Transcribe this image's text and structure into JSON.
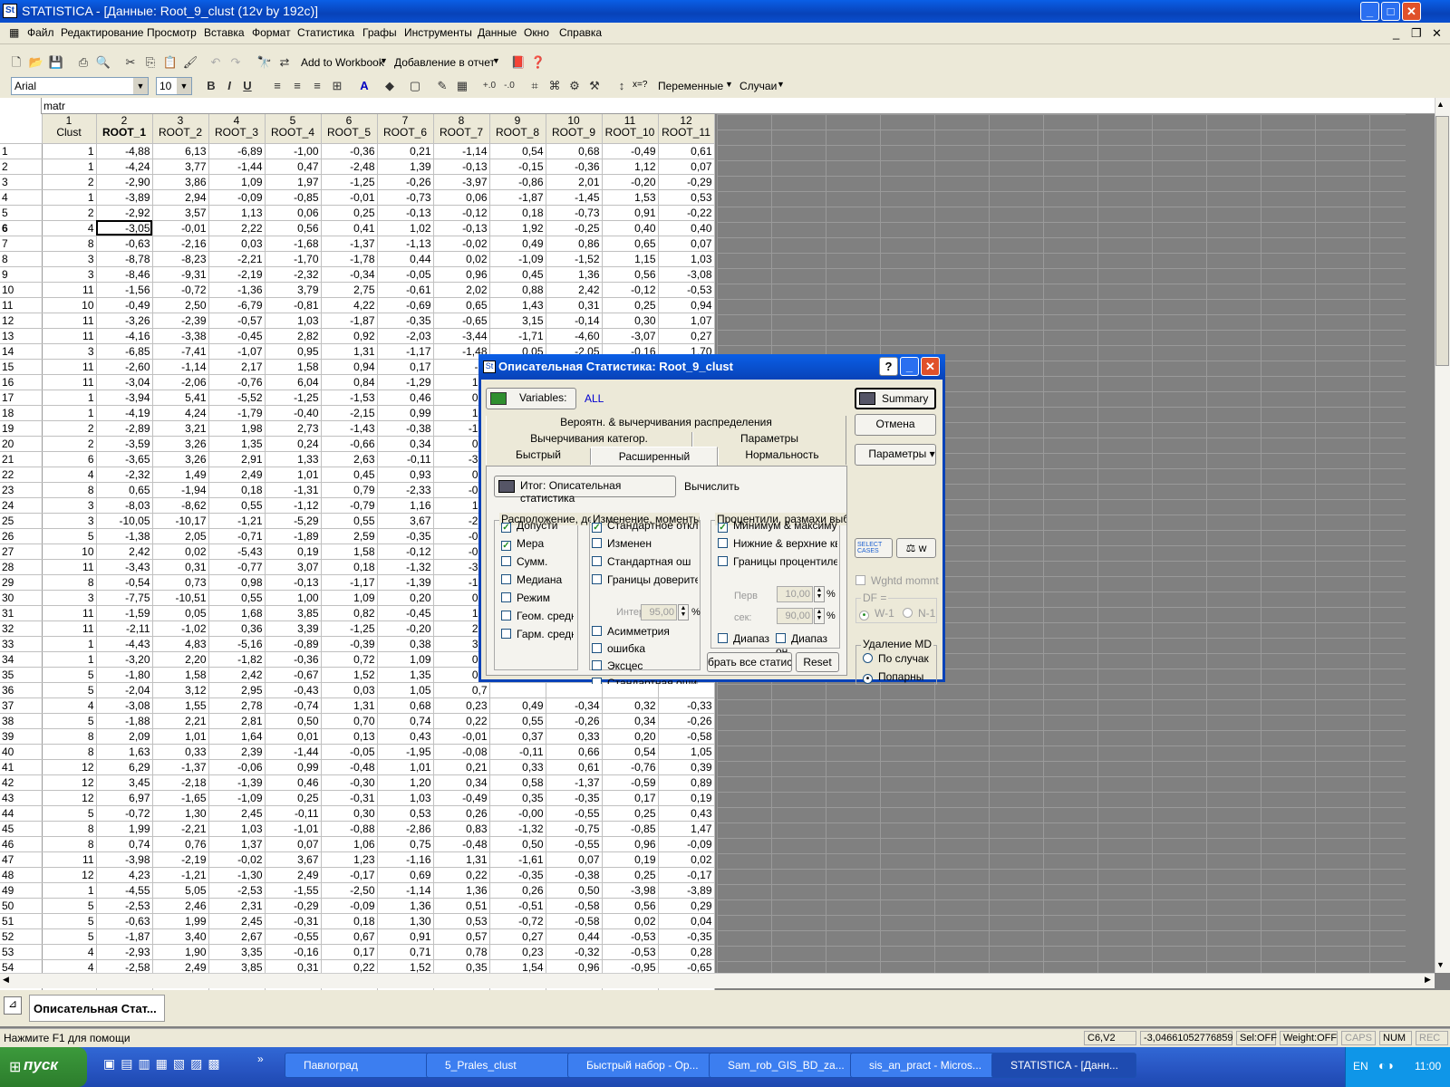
{
  "window": {
    "title": "STATISTICA - [Данные: Root_9_clust (12v by 192c)]"
  },
  "menu": [
    "Файл",
    "Редактирование",
    "Просмотр",
    "Вставка",
    "Формат",
    "Статистика",
    "Графы",
    "Инструменты",
    "Данные",
    "Окно",
    "Справка"
  ],
  "toolbar": {
    "add_to_workbook": "Add to Workbook",
    "add_to_report": "Добавление в отчет",
    "variables": "Переменные",
    "cases": "Случаи",
    "font": "Arial",
    "size": "10"
  },
  "sheet": {
    "title": "matr",
    "col_numbers": [
      "1",
      "2",
      "3",
      "4",
      "5",
      "6",
      "7",
      "8",
      "9",
      "10",
      "11",
      "12"
    ],
    "col_names": [
      "Clust",
      "ROOT_1",
      "ROOT_2",
      "ROOT_3",
      "ROOT_4",
      "ROOT_5",
      "ROOT_6",
      "ROOT_7",
      "ROOT_8",
      "ROOT_9",
      "ROOT_10",
      "ROOT_11"
    ],
    "rows": [
      [
        "1",
        "1",
        "-4,88",
        "6,13",
        "-6,89",
        "-1,00",
        "-0,36",
        "0,21",
        "-1,14",
        "0,54",
        "0,68",
        "-0,49",
        "0,61"
      ],
      [
        "2",
        "1",
        "-4,24",
        "3,77",
        "-1,44",
        "0,47",
        "-2,48",
        "1,39",
        "-0,13",
        "-0,15",
        "-0,36",
        "1,12",
        "0,07"
      ],
      [
        "3",
        "2",
        "-2,90",
        "3,86",
        "1,09",
        "1,97",
        "-1,25",
        "-0,26",
        "-3,97",
        "-0,86",
        "2,01",
        "-0,20",
        "-0,29"
      ],
      [
        "4",
        "1",
        "-3,89",
        "2,94",
        "-0,09",
        "-0,85",
        "-0,01",
        "-0,73",
        "0,06",
        "-1,87",
        "-1,45",
        "1,53",
        "0,53"
      ],
      [
        "5",
        "2",
        "-2,92",
        "3,57",
        "1,13",
        "0,06",
        "0,25",
        "-0,13",
        "-0,12",
        "0,18",
        "-0,73",
        "0,91",
        "-0,22"
      ],
      [
        "6",
        "4",
        "-3,05",
        "-0,01",
        "2,22",
        "0,56",
        "0,41",
        "1,02",
        "-0,13",
        "1,92",
        "-0,25",
        "0,40",
        "0,40"
      ],
      [
        "7",
        "8",
        "-0,63",
        "-2,16",
        "0,03",
        "-1,68",
        "-1,37",
        "-1,13",
        "-0,02",
        "0,49",
        "0,86",
        "0,65",
        "0,07"
      ],
      [
        "8",
        "3",
        "-8,78",
        "-8,23",
        "-2,21",
        "-1,70",
        "-1,78",
        "0,44",
        "0,02",
        "-1,09",
        "-1,52",
        "1,15",
        "1,03"
      ],
      [
        "9",
        "3",
        "-8,46",
        "-9,31",
        "-2,19",
        "-2,32",
        "-0,34",
        "-0,05",
        "0,96",
        "0,45",
        "1,36",
        "0,56",
        "-3,08"
      ],
      [
        "10",
        "11",
        "-1,56",
        "-0,72",
        "-1,36",
        "3,79",
        "2,75",
        "-0,61",
        "2,02",
        "0,88",
        "2,42",
        "-0,12",
        "-0,53"
      ],
      [
        "11",
        "10",
        "-0,49",
        "2,50",
        "-6,79",
        "-0,81",
        "4,22",
        "-0,69",
        "0,65",
        "1,43",
        "0,31",
        "0,25",
        "0,94"
      ],
      [
        "12",
        "11",
        "-3,26",
        "-2,39",
        "-0,57",
        "1,03",
        "-1,87",
        "-0,35",
        "-0,65",
        "3,15",
        "-0,14",
        "0,30",
        "1,07"
      ],
      [
        "13",
        "11",
        "-4,16",
        "-3,38",
        "-0,45",
        "2,82",
        "0,92",
        "-2,03",
        "-3,44",
        "-1,71",
        "-4,60",
        "-3,07",
        "0,27"
      ],
      [
        "14",
        "3",
        "-6,85",
        "-7,41",
        "-1,07",
        "0,95",
        "1,31",
        "-1,17",
        "-1,48",
        "0,05",
        "-2,05",
        "-0,16",
        "1,70"
      ],
      [
        "15",
        "11",
        "-2,60",
        "-1,14",
        "2,17",
        "1,58",
        "0,94",
        "0,17",
        "-2,",
        "",
        "",
        "",
        ""
      ],
      [
        "16",
        "11",
        "-3,04",
        "-2,06",
        "-0,76",
        "6,04",
        "0,84",
        "-1,29",
        "1,7",
        "",
        "",
        "",
        ""
      ],
      [
        "17",
        "1",
        "-3,94",
        "5,41",
        "-5,52",
        "-1,25",
        "-1,53",
        "0,46",
        "0,2",
        "",
        "",
        "",
        ""
      ],
      [
        "18",
        "1",
        "-4,19",
        "4,24",
        "-1,79",
        "-0,40",
        "-2,15",
        "0,99",
        "1,4",
        "",
        "",
        "",
        ""
      ],
      [
        "19",
        "2",
        "-2,89",
        "3,21",
        "1,98",
        "2,73",
        "-1,43",
        "-0,38",
        "-1,9",
        "",
        "",
        "",
        ""
      ],
      [
        "20",
        "2",
        "-3,59",
        "3,26",
        "1,35",
        "0,24",
        "-0,66",
        "0,34",
        "0,1",
        "",
        "",
        "",
        ""
      ],
      [
        "21",
        "6",
        "-3,65",
        "3,26",
        "2,91",
        "1,33",
        "2,63",
        "-0,11",
        "-3,1",
        "",
        "",
        "",
        ""
      ],
      [
        "22",
        "4",
        "-2,32",
        "1,49",
        "2,49",
        "1,01",
        "0,45",
        "0,93",
        "0,6",
        "",
        "",
        "",
        ""
      ],
      [
        "23",
        "8",
        "0,65",
        "-1,94",
        "0,18",
        "-1,31",
        "0,79",
        "-2,33",
        "-0,6",
        "",
        "",
        "",
        ""
      ],
      [
        "24",
        "3",
        "-8,03",
        "-8,62",
        "0,55",
        "-1,12",
        "-0,79",
        "1,16",
        "1,0",
        "",
        "",
        "",
        ""
      ],
      [
        "25",
        "3",
        "-10,05",
        "-10,17",
        "-1,21",
        "-5,29",
        "0,55",
        "3,67",
        "-2,3",
        "",
        "",
        "",
        ""
      ],
      [
        "26",
        "5",
        "-1,38",
        "2,05",
        "-0,71",
        "-1,89",
        "2,59",
        "-0,35",
        "-0,1",
        "",
        "",
        "",
        ""
      ],
      [
        "27",
        "10",
        "2,42",
        "0,02",
        "-5,43",
        "0,19",
        "1,58",
        "-0,12",
        "-0,6",
        "",
        "",
        "",
        ""
      ],
      [
        "28",
        "11",
        "-3,43",
        "0,31",
        "-0,77",
        "3,07",
        "0,18",
        "-1,32",
        "-3,8",
        "",
        "",
        "",
        ""
      ],
      [
        "29",
        "8",
        "-0,54",
        "0,73",
        "0,98",
        "-0,13",
        "-1,17",
        "-1,39",
        "-1,3",
        "",
        "",
        "",
        ""
      ],
      [
        "30",
        "3",
        "-7,75",
        "-10,51",
        "0,55",
        "1,00",
        "1,09",
        "0,20",
        "0,2",
        "",
        "",
        "",
        ""
      ],
      [
        "31",
        "11",
        "-1,59",
        "0,05",
        "1,68",
        "3,85",
        "0,82",
        "-0,45",
        "1,0",
        "",
        "",
        "",
        ""
      ],
      [
        "32",
        "11",
        "-2,11",
        "-1,02",
        "0,36",
        "3,39",
        "-1,25",
        "-0,20",
        "2,2",
        "",
        "",
        "",
        ""
      ],
      [
        "33",
        "1",
        "-4,43",
        "4,83",
        "-5,16",
        "-0,89",
        "-0,39",
        "0,38",
        "3,1",
        "",
        "",
        "",
        ""
      ],
      [
        "34",
        "1",
        "-3,20",
        "2,20",
        "-1,82",
        "-0,36",
        "0,72",
        "1,09",
        "0,5",
        "",
        "",
        "",
        ""
      ],
      [
        "35",
        "5",
        "-1,80",
        "1,58",
        "2,42",
        "-0,67",
        "1,52",
        "1,35",
        "0,2",
        "",
        "",
        "",
        ""
      ],
      [
        "36",
        "5",
        "-2,04",
        "3,12",
        "2,95",
        "-0,43",
        "0,03",
        "1,05",
        "0,7",
        "",
        "",
        "",
        ""
      ],
      [
        "37",
        "4",
        "-3,08",
        "1,55",
        "2,78",
        "-0,74",
        "1,31",
        "0,68",
        "0,23",
        "0,49",
        "-0,34",
        "0,32",
        "-0,33"
      ],
      [
        "38",
        "5",
        "-1,88",
        "2,21",
        "2,81",
        "0,50",
        "0,70",
        "0,74",
        "0,22",
        "0,55",
        "-0,26",
        "0,34",
        "-0,26"
      ],
      [
        "39",
        "8",
        "2,09",
        "1,01",
        "1,64",
        "0,01",
        "0,13",
        "0,43",
        "-0,01",
        "0,37",
        "0,33",
        "0,20",
        "-0,58"
      ],
      [
        "40",
        "8",
        "1,63",
        "0,33",
        "2,39",
        "-1,44",
        "-0,05",
        "-1,95",
        "-0,08",
        "-0,11",
        "0,66",
        "0,54",
        "1,05"
      ],
      [
        "41",
        "12",
        "6,29",
        "-1,37",
        "-0,06",
        "0,99",
        "-0,48",
        "1,01",
        "0,21",
        "0,33",
        "0,61",
        "-0,76",
        "0,39"
      ],
      [
        "42",
        "12",
        "3,45",
        "-2,18",
        "-1,39",
        "0,46",
        "-0,30",
        "1,20",
        "0,34",
        "0,58",
        "-1,37",
        "-0,59",
        "0,89"
      ],
      [
        "43",
        "12",
        "6,97",
        "-1,65",
        "-1,09",
        "0,25",
        "-0,31",
        "1,03",
        "-0,49",
        "0,35",
        "-0,35",
        "0,17",
        "0,19"
      ],
      [
        "44",
        "5",
        "-0,72",
        "1,30",
        "2,45",
        "-0,11",
        "0,30",
        "0,53",
        "0,26",
        "-0,00",
        "-0,55",
        "0,25",
        "0,43"
      ],
      [
        "45",
        "8",
        "1,99",
        "-2,21",
        "1,03",
        "-1,01",
        "-0,88",
        "-2,86",
        "0,83",
        "-1,32",
        "-0,75",
        "-0,85",
        "1,47"
      ],
      [
        "46",
        "8",
        "0,74",
        "0,76",
        "1,37",
        "0,07",
        "1,06",
        "0,75",
        "-0,48",
        "0,50",
        "-0,55",
        "0,96",
        "-0,09"
      ],
      [
        "47",
        "11",
        "-3,98",
        "-2,19",
        "-0,02",
        "3,67",
        "1,23",
        "-1,16",
        "1,31",
        "-1,61",
        "0,07",
        "0,19",
        "0,02"
      ],
      [
        "48",
        "12",
        "4,23",
        "-1,21",
        "-1,30",
        "2,49",
        "-0,17",
        "0,69",
        "0,22",
        "-0,35",
        "-0,38",
        "0,25",
        "-0,17"
      ],
      [
        "49",
        "1",
        "-4,55",
        "5,05",
        "-2,53",
        "-1,55",
        "-2,50",
        "-1,14",
        "1,36",
        "0,26",
        "0,50",
        "-3,98",
        "-3,89"
      ],
      [
        "50",
        "5",
        "-2,53",
        "2,46",
        "2,31",
        "-0,29",
        "-0,09",
        "1,36",
        "0,51",
        "-0,51",
        "-0,58",
        "0,56",
        "0,29"
      ],
      [
        "51",
        "5",
        "-0,63",
        "1,99",
        "2,45",
        "-0,31",
        "0,18",
        "1,30",
        "0,53",
        "-0,72",
        "-0,58",
        "0,02",
        "0,04"
      ],
      [
        "52",
        "5",
        "-1,87",
        "3,40",
        "2,67",
        "-0,55",
        "0,67",
        "0,91",
        "0,57",
        "0,27",
        "0,44",
        "-0,53",
        "-0,35"
      ],
      [
        "53",
        "4",
        "-2,93",
        "1,90",
        "3,35",
        "-0,16",
        "0,17",
        "0,71",
        "0,78",
        "0,23",
        "-0,32",
        "-0,53",
        "0,28"
      ],
      [
        "54",
        "4",
        "-2,58",
        "2,49",
        "3,85",
        "0,31",
        "0,22",
        "1,52",
        "0,35",
        "1,54",
        "0,96",
        "-0,95",
        "-0,65"
      ],
      [
        "55",
        "8",
        "2,02",
        "0,34",
        "1,64",
        "-0,34",
        "-0,19",
        "-0,05",
        "0,02",
        "0,61",
        "0,39",
        "-0,16",
        "0,33"
      ]
    ]
  },
  "dialog": {
    "title": "Описательная Статистика: Root_9_clust",
    "variables_label": "Variables:",
    "variables_value": "ALL",
    "summary": "Summary",
    "cancel": "Отмена",
    "params": "Параметры",
    "tabs_row1": [
      "Вероятн. & вычерчивания распределения"
    ],
    "tabs_row2": [
      "Вычерчивания категор.",
      "Параметры"
    ],
    "tabs_row3": [
      "Быстрый",
      "Расширенный",
      "Нормальность"
    ],
    "itog": "Итог: Описательная статистика",
    "calc": "Вычислить",
    "group1": {
      "title": "Расположение, дов",
      "items": [
        {
          "label": "Допусти",
          "checked": true
        },
        {
          "label": "Мера",
          "checked": true
        },
        {
          "label": "Сумм.",
          "checked": false
        },
        {
          "label": "Медиана",
          "checked": false
        },
        {
          "label": "Режим",
          "checked": false
        },
        {
          "label": "Геом. средн",
          "checked": false
        },
        {
          "label": "Гарм. средн",
          "checked": false
        }
      ]
    },
    "group2": {
      "title": "Изменение, моменты",
      "items": [
        {
          "label": "Стандартное откло",
          "checked": true
        },
        {
          "label": "Изменен",
          "checked": false
        },
        {
          "label": "Стандартная ош",
          "checked": false
        },
        {
          "label": "Границы доверител",
          "checked": false
        }
      ],
      "interval_label": "Интерв",
      "interval_value": "95,00",
      "items2": [
        {
          "label": "Асимметрия",
          "checked": false
        },
        {
          "label": "ошибка",
          "checked": false
        },
        {
          "label": "Эксцес",
          "checked": false
        },
        {
          "label": "Стандартная ошиб",
          "checked": false
        }
      ]
    },
    "group3": {
      "title": "Процентили, размахи выбор",
      "items": [
        {
          "label": "Минимум & максиму",
          "checked": true
        },
        {
          "label": "Нижние & верхние квар",
          "checked": false
        },
        {
          "label": "Границы процентиле",
          "checked": false
        }
      ],
      "first_label": "Перв",
      "first_value": "10,00",
      "second_label": "сек:",
      "second_value": "90,00",
      "range1": "Диапаз",
      "range2": "Диапаз он"
    },
    "select_all": "брать все статист",
    "reset": "Reset",
    "select_cases": "SELECT CASES",
    "wghtd": "Wghtd momnts",
    "df_label": "DF =",
    "df_w1": "W-1",
    "df_n1": "N-1",
    "md_title": "Удаление MD",
    "md_casewise": "По случак",
    "md_pairwise": "Попарны"
  },
  "doc_tab": "Описательная Стат...",
  "status": {
    "help": "Нажмите F1 для помощи",
    "cell": "C6,V2",
    "value": "-3,04661052776859",
    "sel": "Sel:OFF",
    "weight": "Weight:OFF",
    "caps": "CAPS",
    "num": "NUM",
    "rec": "REC"
  },
  "taskbar": {
    "start": "пуск",
    "tasks": [
      "Павлоград",
      "5_Prales_clust",
      "Быстрый набор - Op...",
      "Sam_rob_GIS_BD_za...",
      "sis_an_pract - Micros...",
      "STATISTICA - [Данн..."
    ],
    "lang": "EN",
    "time": "11:00"
  }
}
